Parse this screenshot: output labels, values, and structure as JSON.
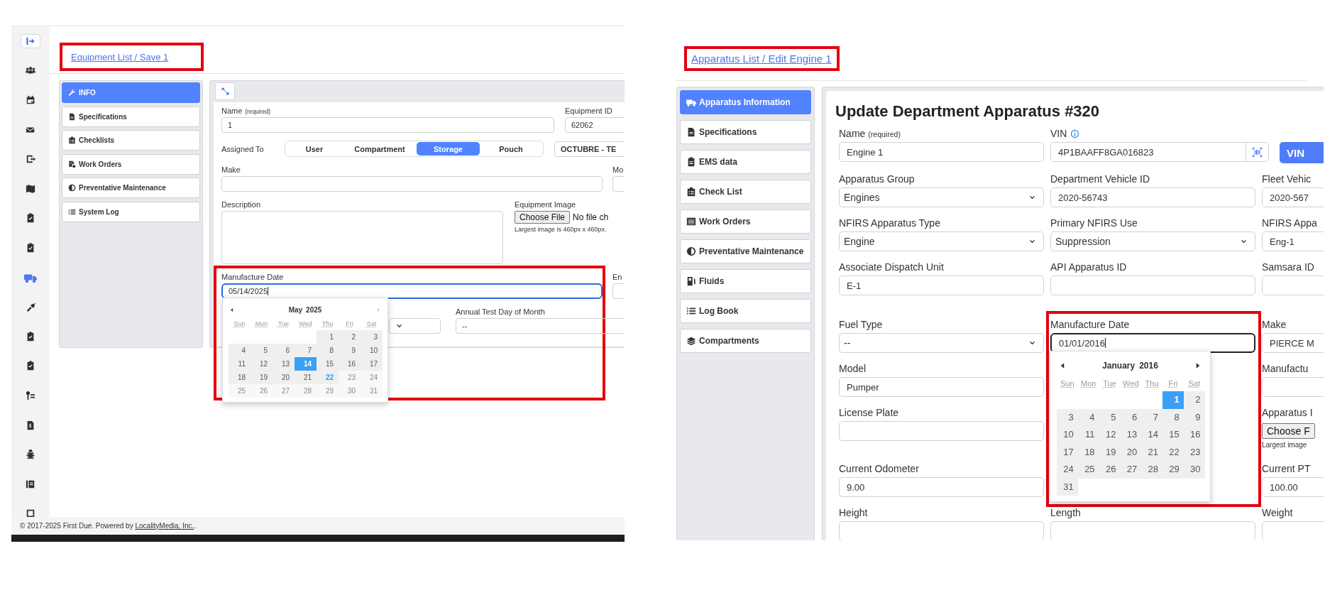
{
  "left": {
    "sidebar": [
      {
        "selected": false
      },
      {
        "selected": false
      },
      {
        "selected": false
      },
      {
        "selected": false
      },
      {
        "selected": false
      },
      {
        "selected": false
      },
      {
        "selected": false
      },
      {
        "selected": false
      },
      {
        "selected": true
      },
      {
        "selected": false
      },
      {
        "selected": false
      },
      {
        "selected": false
      },
      {
        "selected": false
      },
      {
        "selected": false
      },
      {
        "selected": false
      },
      {
        "selected": false
      },
      {
        "selected": false
      }
    ],
    "breadcrumb": {
      "text": "Equipment List / Save 1",
      "highlighted": true
    },
    "nav": [
      {
        "label": "INFO",
        "selected": true
      },
      {
        "label": "Specifications",
        "selected": false
      },
      {
        "label": "Checklists",
        "selected": false
      },
      {
        "label": "Work Orders",
        "selected": false
      },
      {
        "label": "Preventative Maintenance",
        "selected": false
      },
      {
        "label": "System Log",
        "selected": false
      }
    ],
    "form": {
      "rows": [
        [
          {
            "kind": "text",
            "label": "Name",
            "note": "(required)",
            "value": "1"
          },
          {
            "kind": "text",
            "label": "Equipment ID",
            "value": "62062"
          }
        ],
        [
          {
            "kind": "segmented",
            "label": "Assigned To",
            "options": [
              {
                "label": "User",
                "selected": false
              },
              {
                "label": "Compartment",
                "selected": false
              },
              {
                "label": "Storage",
                "selected": true
              },
              {
                "label": "Pouch",
                "selected": false
              }
            ]
          },
          {
            "kind": "select",
            "value": "OCTUBRE - TE"
          }
        ],
        [
          {
            "kind": "text",
            "label": "Make"
          },
          {
            "kind": "text",
            "label": "Mo"
          }
        ],
        [
          {
            "kind": "textarea",
            "label": "Description"
          },
          {
            "kind": "file",
            "label": "Equipment Image",
            "button": "Choose File",
            "status": "No file ch",
            "hint": "Largest image is 460px x 460px."
          }
        ],
        [
          {
            "kind": "date",
            "label": "Manufacture Date",
            "value": "05/14/2025",
            "focused": true,
            "highlighted": true
          },
          {
            "kind": "text",
            "label": "En"
          }
        ],
        [
          {
            "kind": "select",
            "arrow": true
          },
          {
            "kind": "select",
            "label": "Annual Test Day of Month",
            "value": "--"
          }
        ]
      ],
      "date_picker": {
        "month": "May",
        "year": "2025",
        "next_disabled": true,
        "weekdays": [
          "Sun",
          "Mon",
          "Tue",
          "Wed",
          "Thu",
          "Fri",
          "Sat"
        ],
        "weeks": [
          {
            "days": [
              {
                "kind": "blank"
              },
              {
                "kind": "blank"
              },
              {
                "kind": "blank"
              },
              {
                "kind": "blank"
              },
              {
                "kind": "day",
                "day": "1",
                "selected": false,
                "today": false,
                "disabled": false
              },
              {
                "kind": "day",
                "day": "2",
                "selected": false,
                "today": false,
                "disabled": false
              },
              {
                "kind": "day",
                "day": "3",
                "selected": false,
                "today": false,
                "disabled": false
              }
            ]
          },
          {
            "days": [
              {
                "kind": "day",
                "day": "4",
                "selected": false,
                "today": false,
                "disabled": false
              },
              {
                "kind": "day",
                "day": "5",
                "selected": false,
                "today": false,
                "disabled": false
              },
              {
                "kind": "day",
                "day": "6",
                "selected": false,
                "today": false,
                "disabled": false
              },
              {
                "kind": "day",
                "day": "7",
                "selected": false,
                "today": false,
                "disabled": false
              },
              {
                "kind": "day",
                "day": "8",
                "selected": false,
                "today": false,
                "disabled": false
              },
              {
                "kind": "day",
                "day": "9",
                "selected": false,
                "today": false,
                "disabled": false
              },
              {
                "kind": "day",
                "day": "10",
                "selected": false,
                "today": false,
                "disabled": false
              }
            ]
          },
          {
            "days": [
              {
                "kind": "day",
                "day": "11",
                "selected": false,
                "today": false,
                "disabled": false
              },
              {
                "kind": "day",
                "day": "12",
                "selected": false,
                "today": false,
                "disabled": false
              },
              {
                "kind": "day",
                "day": "13",
                "selected": false,
                "today": false,
                "disabled": false
              },
              {
                "kind": "day",
                "day": "14",
                "selected": true,
                "today": false,
                "disabled": false
              },
              {
                "kind": "day",
                "day": "15",
                "selected": false,
                "today": false,
                "disabled": false
              },
              {
                "kind": "day",
                "day": "16",
                "selected": false,
                "today": false,
                "disabled": false
              },
              {
                "kind": "day",
                "day": "17",
                "selected": false,
                "today": false,
                "disabled": false
              }
            ]
          },
          {
            "days": [
              {
                "kind": "day",
                "day": "18",
                "selected": false,
                "today": false,
                "disabled": false
              },
              {
                "kind": "day",
                "day": "19",
                "selected": false,
                "today": false,
                "disabled": false
              },
              {
                "kind": "day",
                "day": "20",
                "selected": false,
                "today": false,
                "disabled": false
              },
              {
                "kind": "day",
                "day": "21",
                "selected": false,
                "today": false,
                "disabled": false
              },
              {
                "kind": "day",
                "day": "22",
                "selected": false,
                "today": true,
                "disabled": false
              },
              {
                "kind": "day",
                "day": "23",
                "selected": false,
                "today": false,
                "disabled": true
              },
              {
                "kind": "day",
                "day": "24",
                "selected": false,
                "today": false,
                "disabled": true
              }
            ]
          },
          {
            "days": [
              {
                "kind": "day",
                "day": "25",
                "selected": false,
                "today": false,
                "disabled": true
              },
              {
                "kind": "day",
                "day": "26",
                "selected": false,
                "today": false,
                "disabled": true
              },
              {
                "kind": "day",
                "day": "27",
                "selected": false,
                "today": false,
                "disabled": true
              },
              {
                "kind": "day",
                "day": "28",
                "selected": false,
                "today": false,
                "disabled": true
              },
              {
                "kind": "day",
                "day": "29",
                "selected": false,
                "today": false,
                "disabled": true
              },
              {
                "kind": "day",
                "day": "30",
                "selected": false,
                "today": false,
                "disabled": true
              },
              {
                "kind": "day",
                "day": "31",
                "selected": false,
                "today": false,
                "disabled": true
              }
            ]
          }
        ]
      }
    },
    "footer": {
      "text": "© 2017-2025 First Due. Powered by",
      "link": "LocalityMedia, Inc.",
      "end": "."
    }
  },
  "right": {
    "breadcrumb": {
      "text": "Apparatus List / Edit Engine 1",
      "highlighted": true
    },
    "nav": [
      {
        "label": "Apparatus Information",
        "selected": true
      },
      {
        "label": "Specifications",
        "selected": false
      },
      {
        "label": "EMS data",
        "selected": false
      },
      {
        "label": "Check List",
        "selected": false
      },
      {
        "label": "Work Orders",
        "selected": false
      },
      {
        "label": "Preventative Maintenance",
        "selected": false
      },
      {
        "label": "Fluids",
        "selected": false
      },
      {
        "label": "Log Book",
        "selected": false
      },
      {
        "label": "Compartments",
        "selected": false
      }
    ],
    "form": {
      "title": "Update Department Apparatus #320",
      "rows": [
        [
          {
            "kind": "text",
            "label": "Name",
            "note": "(required)",
            "value": "Engine 1"
          },
          {
            "kind": "text",
            "label": "VIN",
            "info": true,
            "scan_button": true,
            "value": "4P1BAAFF8GA016823"
          },
          {
            "kind": "button",
            "label": "VIN"
          }
        ],
        [
          {
            "kind": "select",
            "label": "Apparatus Group",
            "value": "Engines",
            "arrow": true
          },
          {
            "kind": "text",
            "label": "Department Vehicle ID",
            "value": "2020-56743"
          },
          {
            "kind": "text",
            "label": "Fleet Vehic",
            "value": "2020-567"
          }
        ],
        [
          {
            "kind": "select",
            "label": "NFIRS Apparatus Type",
            "value": "Engine",
            "arrow": true
          },
          {
            "kind": "select",
            "label": "Primary NFIRS Use",
            "value": "Suppression",
            "arrow": true
          },
          {
            "kind": "text",
            "label": "NFIRS Appa",
            "value": "Eng-1"
          }
        ],
        [
          {
            "kind": "text",
            "label": "Associate Dispatch Unit",
            "value": "E-1"
          },
          {
            "kind": "text",
            "label": "API Apparatus ID"
          },
          {
            "kind": "text",
            "label": "Samsara ID"
          }
        ],
        [
          {
            "kind": "select",
            "label": "Fuel Type",
            "value": "--",
            "arrow": true
          },
          {
            "kind": "date",
            "label": "Manufacture Date",
            "value": "01/01/2016",
            "focused": true,
            "highlighted": true
          },
          {
            "kind": "text",
            "label": "Make",
            "value": "PIERCE M"
          }
        ],
        [
          {
            "kind": "text",
            "label": "Model",
            "value": "Pumper"
          },
          {
            "kind": "blank"
          },
          {
            "kind": "text",
            "label": "Manufactu"
          }
        ],
        [
          {
            "kind": "text",
            "label": "License Plate"
          },
          {
            "kind": "blank"
          },
          {
            "kind": "file",
            "label": "Apparatus I",
            "button": "Choose F",
            "hint": "Largest image"
          }
        ],
        [
          {
            "kind": "text",
            "label": "Current Odometer",
            "value": "9.00"
          },
          {
            "kind": "blank"
          },
          {
            "kind": "text",
            "label": "Current PT",
            "value": "100.00"
          }
        ],
        [
          {
            "kind": "text",
            "label": "Height"
          },
          {
            "kind": "text",
            "label": "Length"
          },
          {
            "kind": "text",
            "label": "Weight"
          }
        ]
      ],
      "date_picker": {
        "month": "January",
        "year": "2016",
        "next_disabled": false,
        "weekdays": [
          "Sun",
          "Mon",
          "Tue",
          "Wed",
          "Thu",
          "Fri",
          "Sat"
        ],
        "weeks": [
          {
            "days": [
              {
                "kind": "blank"
              },
              {
                "kind": "blank"
              },
              {
                "kind": "blank"
              },
              {
                "kind": "blank"
              },
              {
                "kind": "blank"
              },
              {
                "kind": "day",
                "day": "1",
                "selected": true,
                "today": false,
                "disabled": false
              },
              {
                "kind": "day",
                "day": "2",
                "selected": false,
                "today": false,
                "disabled": false
              }
            ]
          },
          {
            "days": [
              {
                "kind": "day",
                "day": "3",
                "selected": false,
                "today": false,
                "disabled": false
              },
              {
                "kind": "day",
                "day": "4",
                "selected": false,
                "today": false,
                "disabled": false
              },
              {
                "kind": "day",
                "day": "5",
                "selected": false,
                "today": false,
                "disabled": false
              },
              {
                "kind": "day",
                "day": "6",
                "selected": false,
                "today": false,
                "disabled": false
              },
              {
                "kind": "day",
                "day": "7",
                "selected": false,
                "today": false,
                "disabled": false
              },
              {
                "kind": "day",
                "day": "8",
                "selected": false,
                "today": false,
                "disabled": false
              },
              {
                "kind": "day",
                "day": "9",
                "selected": false,
                "today": false,
                "disabled": false
              }
            ]
          },
          {
            "days": [
              {
                "kind": "day",
                "day": "10",
                "selected": false,
                "today": false,
                "disabled": false
              },
              {
                "kind": "day",
                "day": "11",
                "selected": false,
                "today": false,
                "disabled": false
              },
              {
                "kind": "day",
                "day": "12",
                "selected": false,
                "today": false,
                "disabled": false
              },
              {
                "kind": "day",
                "day": "13",
                "selected": false,
                "today": false,
                "disabled": false
              },
              {
                "kind": "day",
                "day": "14",
                "selected": false,
                "today": false,
                "disabled": false
              },
              {
                "kind": "day",
                "day": "15",
                "selected": false,
                "today": false,
                "disabled": false
              },
              {
                "kind": "day",
                "day": "16",
                "selected": false,
                "today": false,
                "disabled": false
              }
            ]
          },
          {
            "days": [
              {
                "kind": "day",
                "day": "17",
                "selected": false,
                "today": false,
                "disabled": false
              },
              {
                "kind": "day",
                "day": "18",
                "selected": false,
                "today": false,
                "disabled": false
              },
              {
                "kind": "day",
                "day": "19",
                "selected": false,
                "today": false,
                "disabled": false
              },
              {
                "kind": "day",
                "day": "20",
                "selected": false,
                "today": false,
                "disabled": false
              },
              {
                "kind": "day",
                "day": "21",
                "selected": false,
                "today": false,
                "disabled": false
              },
              {
                "kind": "day",
                "day": "22",
                "selected": false,
                "today": false,
                "disabled": false
              },
              {
                "kind": "day",
                "day": "23",
                "selected": false,
                "today": false,
                "disabled": false
              }
            ]
          },
          {
            "days": [
              {
                "kind": "day",
                "day": "24",
                "selected": false,
                "today": false,
                "disabled": false
              },
              {
                "kind": "day",
                "day": "25",
                "selected": false,
                "today": false,
                "disabled": false
              },
              {
                "kind": "day",
                "day": "26",
                "selected": false,
                "today": false,
                "disabled": false
              },
              {
                "kind": "day",
                "day": "27",
                "selected": false,
                "today": false,
                "disabled": false
              },
              {
                "kind": "day",
                "day": "28",
                "selected": false,
                "today": false,
                "disabled": false
              },
              {
                "kind": "day",
                "day": "29",
                "selected": false,
                "today": false,
                "disabled": false
              },
              {
                "kind": "day",
                "day": "30",
                "selected": false,
                "today": false,
                "disabled": false
              }
            ]
          },
          {
            "days": [
              {
                "kind": "day",
                "day": "31",
                "selected": false,
                "today": false,
                "disabled": false
              }
            ]
          }
        ]
      }
    }
  }
}
